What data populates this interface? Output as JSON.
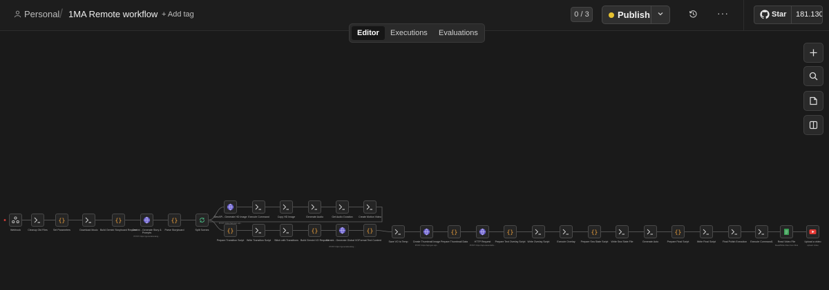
{
  "header": {
    "project": "Personal",
    "workflow_title": "1MA Remote workflow",
    "add_tag": "+ Add tag",
    "counter": "0 / 3",
    "publish": "Publish",
    "github_star": "Star",
    "github_count": "181.130"
  },
  "tabs": [
    "Editor",
    "Executions",
    "Evaluations"
  ],
  "active_tab": "Editor",
  "accent": {
    "publish_dot": "#e7c230",
    "trigger_dot": "#e0403a"
  },
  "side_buttons": [
    "plus-icon",
    "zoom-icon",
    "sticky-note-icon",
    "panel-icon"
  ],
  "nodes": [
    {
      "label": "Webhook",
      "sub": "",
      "icon": "webhook"
    },
    {
      "label": "Cleanup Old Files",
      "sub": "",
      "icon": "terminal"
    },
    {
      "label": "Set Parameters",
      "sub": "",
      "icon": "braces"
    },
    {
      "label": "Download Music",
      "sub": "",
      "icon": "terminal"
    },
    {
      "label": "Build Gemini Storyboard Request",
      "sub": "",
      "icon": "braces"
    },
    {
      "label": "Gemini - Generate Story & Prompts",
      "sub": "POST: https://generativelang...",
      "icon": "globe"
    },
    {
      "label": "Parse Storyboard",
      "sub": "",
      "icon": "braces"
    },
    {
      "label": "Split Scenes",
      "sub": "",
      "icon": "loop"
    },
    {
      "label": "GenAPI - Generate HD Image",
      "sub": "POST: https://api.gen-api...",
      "icon": "globe"
    },
    {
      "label": "Execute Command",
      "sub": "",
      "icon": "terminal"
    },
    {
      "label": "Copy HD Image",
      "sub": "",
      "icon": "terminal"
    },
    {
      "label": "Generate Audio",
      "sub": "",
      "icon": "terminal"
    },
    {
      "label": "Get Audio Duration",
      "sub": "",
      "icon": "terminal"
    },
    {
      "label": "Create Motion Video",
      "sub": "",
      "icon": "terminal"
    },
    {
      "label": "Prepare Transition Script",
      "sub": "",
      "icon": "braces"
    },
    {
      "label": "Write Transition Script",
      "sub": "",
      "icon": "terminal"
    },
    {
      "label": "Stitch with Transitions",
      "sub": "",
      "icon": "terminal"
    },
    {
      "label": "Build Gemini VO Request",
      "sub": "",
      "icon": "braces"
    },
    {
      "label": "Gemini - Generate Global VO",
      "sub": "POST: https://generativelang...",
      "icon": "globe"
    },
    {
      "label": "Format Text Content",
      "sub": "",
      "icon": "braces"
    },
    {
      "label": "Save VO to Temp",
      "sub": "",
      "icon": "terminal"
    },
    {
      "label": "Create Thumbnail Image",
      "sub": "POST: https://api.gen-api...",
      "icon": "globe"
    },
    {
      "label": "Prepare Thumbnail Data",
      "sub": "",
      "icon": "braces"
    },
    {
      "label": "HTTP Request",
      "sub": "POST: https://api.elevenlabs...",
      "icon": "globe"
    },
    {
      "label": "Prepare Text Overlay Script",
      "sub": "",
      "icon": "braces"
    },
    {
      "label": "Write Overlay Script",
      "sub": "",
      "icon": "terminal"
    },
    {
      "label": "Execute Overlay",
      "sub": "",
      "icon": "terminal"
    },
    {
      "label": "Prepare Sea State Script",
      "sub": "",
      "icon": "braces"
    },
    {
      "label": "Write Sea State File",
      "sub": "",
      "icon": "terminal"
    },
    {
      "label": "Generate Auto",
      "sub": "",
      "icon": "terminal"
    },
    {
      "label": "Prepare Final Script",
      "sub": "",
      "icon": "braces"
    },
    {
      "label": "Write Final Script",
      "sub": "",
      "icon": "terminal"
    },
    {
      "label": "Final Polish Execution",
      "sub": "",
      "icon": "terminal"
    },
    {
      "label": "Execute Command1",
      "sub": "",
      "icon": "terminal"
    },
    {
      "label": "Read Video File",
      "sub": "Read/Write Files from Disk",
      "icon": "file"
    },
    {
      "label": "Upload a video",
      "sub": "upload: video",
      "icon": "youtube"
    }
  ]
}
